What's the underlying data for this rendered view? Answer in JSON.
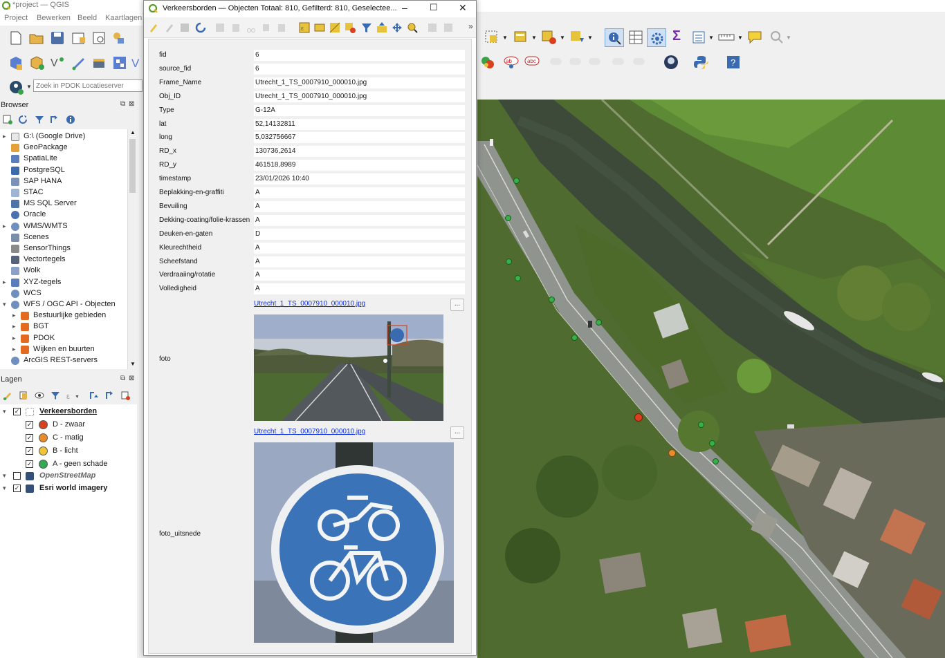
{
  "app": {
    "title": "*project — QGIS",
    "menu": [
      "Project",
      "Bewerken",
      "Beeld",
      "Kaartlagen"
    ]
  },
  "locator": {
    "placeholder": "Zoek in PDOK Locatieserver"
  },
  "browser": {
    "title": "Browser",
    "items": [
      {
        "label": "G:\\ (Google Drive)",
        "icon": "folder-icon",
        "color": "#e8e8e8",
        "expandable": true
      },
      {
        "label": "GeoPackage",
        "icon": "geopackage-icon",
        "color": "#e3a13a",
        "expandable": false
      },
      {
        "label": "SpatiaLite",
        "icon": "spatialite-icon",
        "color": "#5b7dba",
        "expandable": false
      },
      {
        "label": "PostgreSQL",
        "icon": "postgresql-icon",
        "color": "#3d6aa8",
        "expandable": false
      },
      {
        "label": "SAP HANA",
        "icon": "saphana-icon",
        "color": "#7a92b8",
        "expandable": false
      },
      {
        "label": "STAC",
        "icon": "stac-icon",
        "color": "#9fb4d2",
        "expandable": false
      },
      {
        "label": "MS SQL Server",
        "icon": "mssql-icon",
        "color": "#4d73a8",
        "expandable": false
      },
      {
        "label": "Oracle",
        "icon": "oracle-icon",
        "color": "#4a70b0",
        "expandable": false
      },
      {
        "label": "WMS/WMTS",
        "icon": "globe-icon",
        "color": "#6f8fbf",
        "expandable": true
      },
      {
        "label": "Scenes",
        "icon": "scenes-icon",
        "color": "#7b8ea8",
        "expandable": false
      },
      {
        "label": "SensorThings",
        "icon": "sensor-icon",
        "color": "#8a8a8a",
        "expandable": false
      },
      {
        "label": "Vectortegels",
        "icon": "vectortiles-icon",
        "color": "#56627a",
        "expandable": false
      },
      {
        "label": "Wolk",
        "icon": "cloud-icon",
        "color": "#8aa0c4",
        "expandable": false
      },
      {
        "label": "XYZ-tegels",
        "icon": "xyz-icon",
        "color": "#5b7dba",
        "expandable": true
      },
      {
        "label": "WCS",
        "icon": "globe-icon",
        "color": "#6f8fbf",
        "expandable": false
      },
      {
        "label": "WFS / OGC API - Objecten",
        "icon": "globe-icon",
        "color": "#6f8fbf",
        "expandable": true,
        "expanded": true
      },
      {
        "label": "Bestuurlijke gebieden",
        "icon": "connection-icon",
        "color": "#e36a1e",
        "expandable": true,
        "child": true
      },
      {
        "label": "BGT",
        "icon": "connection-icon",
        "color": "#e36a1e",
        "expandable": true,
        "child": true
      },
      {
        "label": "PDOK",
        "icon": "connection-icon",
        "color": "#e36a1e",
        "expandable": true,
        "child": true
      },
      {
        "label": "Wijken en buurten",
        "icon": "connection-icon",
        "color": "#e36a1e",
        "expandable": true,
        "child": true
      },
      {
        "label": "ArcGIS REST-servers",
        "icon": "arcgis-icon",
        "color": "#6f8fbf",
        "expandable": false
      }
    ]
  },
  "layers": {
    "title": "Lagen",
    "items": [
      {
        "label": "Verkeersborden",
        "checked": true,
        "bold": true,
        "underline": true,
        "icon": "points-layer-icon"
      },
      {
        "label": "D - zwaar",
        "checked": true,
        "child": true,
        "color": "#d9401f"
      },
      {
        "label": "C - matig",
        "checked": true,
        "child": true,
        "color": "#e88a2e"
      },
      {
        "label": "B - licht",
        "checked": true,
        "child": true,
        "color": "#f2c431"
      },
      {
        "label": "A - geen schade",
        "checked": true,
        "child": true,
        "color": "#36a852"
      },
      {
        "label": "OpenStreetMap",
        "checked": false,
        "bold": true,
        "italic": true,
        "icon": "raster-layer-icon"
      },
      {
        "label": "Esri world imagery",
        "checked": true,
        "bold": true,
        "icon": "raster-layer-icon"
      }
    ]
  },
  "dialog": {
    "title": "Verkeersborden — Objecten Totaal: 810, Gefilterd: 810, Geselectee...",
    "fields": [
      {
        "label": "fid",
        "value": "6"
      },
      {
        "label": "source_fid",
        "value": "6"
      },
      {
        "label": "Frame_Name",
        "value": "Utrecht_1_TS_0007910_000010.jpg"
      },
      {
        "label": "Obj_ID",
        "value": "Utrecht_1_TS_0007910_000010.jpg"
      },
      {
        "label": "Type",
        "value": "G-12A"
      },
      {
        "label": "lat",
        "value": "52,14132811"
      },
      {
        "label": "long",
        "value": "5,032756667"
      },
      {
        "label": "RD_x",
        "value": "130736,2614"
      },
      {
        "label": "RD_y",
        "value": "461518,8989"
      },
      {
        "label": "timestamp",
        "value": "23/01/2026 10:40"
      },
      {
        "label": "Beplakking-en-graffiti",
        "value": "A"
      },
      {
        "label": "Bevuiling",
        "value": "A"
      },
      {
        "label": "Dekking-coating/folie-krassen",
        "value": "A"
      },
      {
        "label": "Deuken-en-gaten",
        "value": "D"
      },
      {
        "label": "Kleurechtheid",
        "value": "A"
      },
      {
        "label": "Scheefstand",
        "value": "A"
      },
      {
        "label": "Verdraaiing/rotatie",
        "value": "A"
      },
      {
        "label": "Volledigheid",
        "value": "A"
      }
    ],
    "foto": {
      "label": "foto",
      "link": "Utrecht_1_TS_0007910_000010.jpg",
      "button": "..."
    },
    "foto_uitsnede": {
      "label": "foto_uitsnede",
      "link": "Utrecht_1_TS_0007910_000010.jpg",
      "button": "..."
    }
  },
  "colors": {
    "accent": "#0b2ee0",
    "severity_d": "#d9401f",
    "severity_c": "#e88a2e",
    "severity_b": "#f2c431",
    "severity_a": "#36a852"
  }
}
